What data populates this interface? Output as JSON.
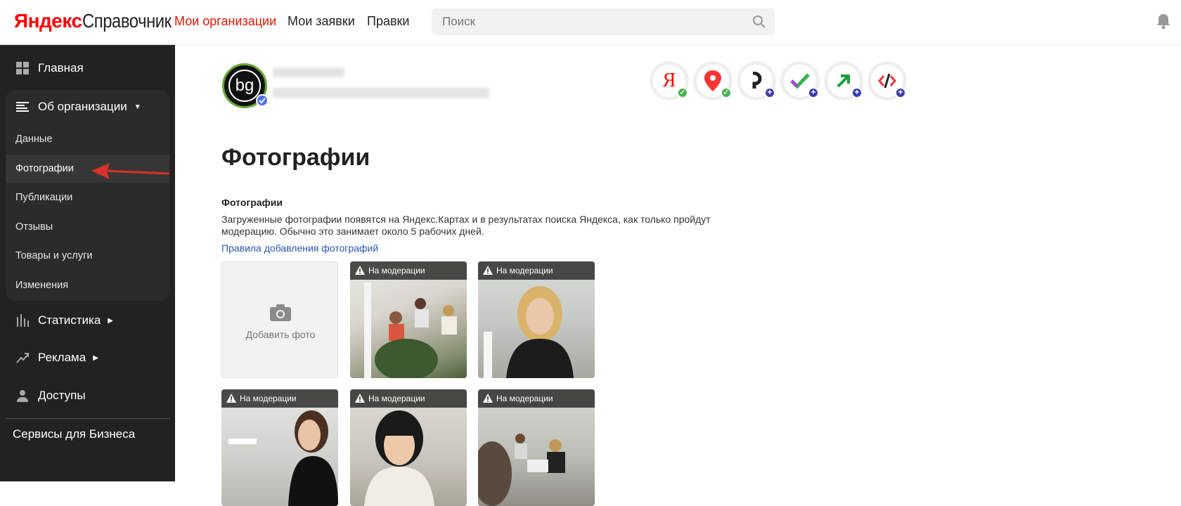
{
  "header": {
    "logo_ya": "Яндекс",
    "logo_sp": "Справочник",
    "nav": [
      "Мои организации",
      "Мои заявки",
      "Правки"
    ],
    "search_placeholder": "Поиск"
  },
  "sidebar": {
    "home": "Главная",
    "about": "Об организации",
    "sub_items": [
      "Данные",
      "Фотографии",
      "Публикации",
      "Отзывы",
      "Товары и услуги",
      "Изменения"
    ],
    "stats": "Статистика",
    "ads": "Реклама",
    "access": "Доступы",
    "business": "Сервисы для Бизнеса"
  },
  "org": {
    "avatar_text": "bg"
  },
  "services": [
    {
      "name": "yandex-search-icon",
      "status": "ok"
    },
    {
      "name": "maps-pin-icon",
      "status": "ok"
    },
    {
      "name": "zen-icon",
      "status": "add"
    },
    {
      "name": "checkmark-service-icon",
      "status": "add"
    },
    {
      "name": "direct-arrow-icon",
      "status": "add"
    },
    {
      "name": "code-tools-icon",
      "status": "add"
    }
  ],
  "main": {
    "title": "Фотографии",
    "section_title": "Фотографии",
    "description": "Загруженные фотографии появятся на Яндекс.Картах и в результатах поиска Яндекса, как только пройдут модерацию. Обычно это занимает около 5 рабочих дней.",
    "rules_link": "Правила добавления фотографий",
    "add_photo": "Добавить фото",
    "moderation_label": "На модерации"
  },
  "colors": {
    "accent": "#e61400",
    "sidebar": "#222222",
    "link": "#2a55b8"
  }
}
